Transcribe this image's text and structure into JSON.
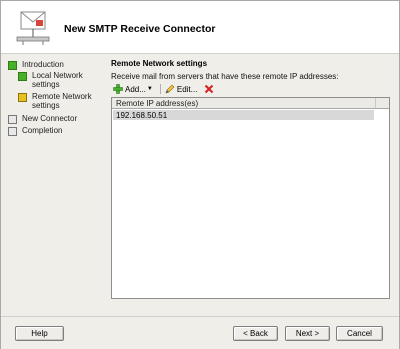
{
  "window": {
    "title": "New SMTP Receive Connector"
  },
  "nav": {
    "items": [
      {
        "label": "Introduction",
        "status": "complete"
      },
      {
        "label": "Local Network settings",
        "status": "complete"
      },
      {
        "label": "Remote Network settings",
        "status": "current"
      },
      {
        "label": "New Connector",
        "status": "pending"
      },
      {
        "label": "Completion",
        "status": "pending"
      }
    ]
  },
  "main": {
    "section_title": "Remote Network settings",
    "description": "Receive mail from servers that have these remote IP addresses:",
    "toolbar": {
      "add_label": "Add...",
      "edit_label": "Edit...",
      "delete_icon": "red-x-icon"
    },
    "table": {
      "column": "Remote IP address(es)",
      "rows": [
        "192.168.50.51"
      ]
    }
  },
  "footer": {
    "help_label": "Help",
    "back_label": "< Back",
    "next_label": "Next >",
    "cancel_label": "Cancel"
  },
  "colors": {
    "complete": "#49b02a",
    "current": "#e7c21f",
    "pending": "#e8e8e8",
    "delete": "#d62020"
  }
}
